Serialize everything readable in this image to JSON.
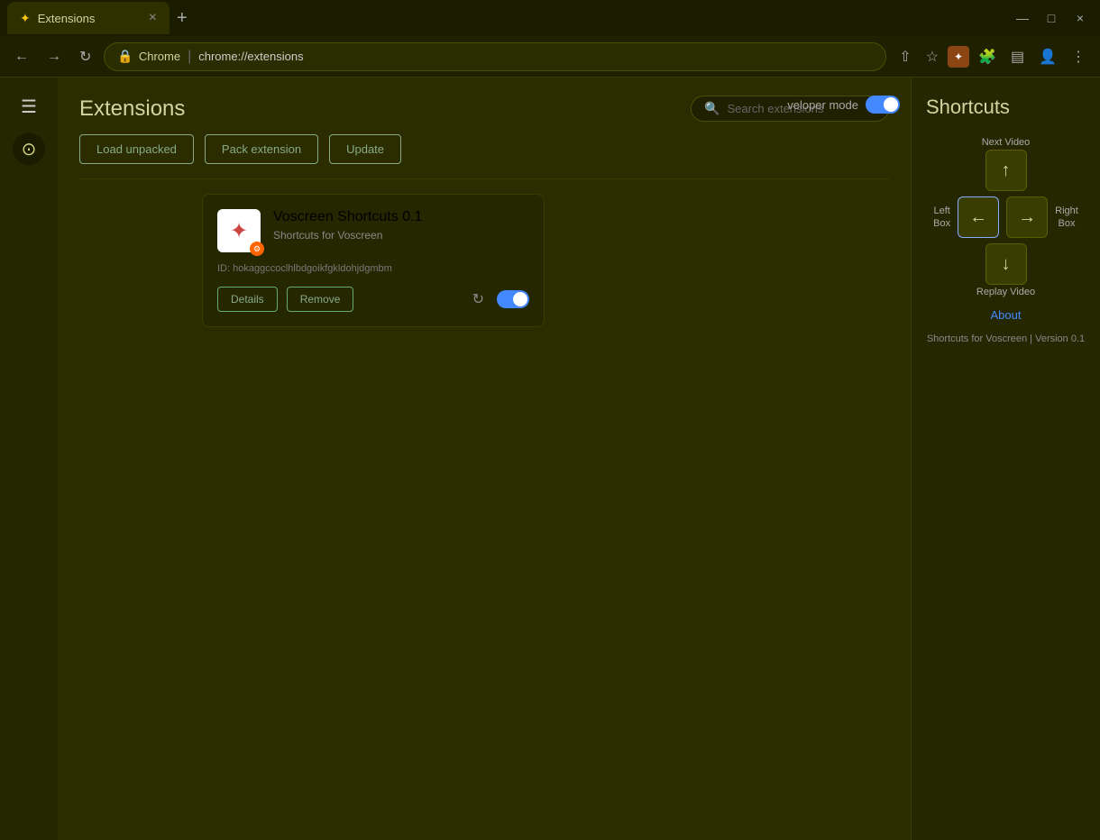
{
  "window": {
    "title": "Extensions",
    "tab_close": "×",
    "new_tab": "+",
    "minimize": "—",
    "maximize": "□",
    "close": "×"
  },
  "address_bar": {
    "security_icon": "🔒",
    "site_name": "Chrome",
    "separator": "|",
    "url": "chrome://extensions",
    "back_icon": "←",
    "forward_icon": "→",
    "refresh_icon": "↻"
  },
  "header": {
    "logo_icon": "⊙",
    "title": "Extensions",
    "search_placeholder": "Search extensions"
  },
  "action_buttons": {
    "load_unpacked": "Load unpacked",
    "pack_extension": "Pack extension",
    "update": "Update"
  },
  "extension": {
    "name": "Voscreen Shortcuts",
    "version": "0.1",
    "description": "Shortcuts for Voscreen",
    "id_label": "ID: hokaggccoclhlbdgoikfgkldohjdgmbm",
    "details_btn": "Details",
    "remove_btn": "Remove"
  },
  "shortcuts_panel": {
    "title": "Shortcuts",
    "next_video_label": "Next Video",
    "left_box_label": "Left\nBox",
    "right_box_label": "Right\nBox",
    "replay_video_label": "Replay Video",
    "up_arrow": "↑",
    "left_arrow": "←",
    "right_arrow": "→",
    "down_arrow": "↓",
    "about_link": "About",
    "footer_text": "Shortcuts for Voscreen | Version 0.1"
  },
  "developer_mode": {
    "label": "veloper mode"
  }
}
